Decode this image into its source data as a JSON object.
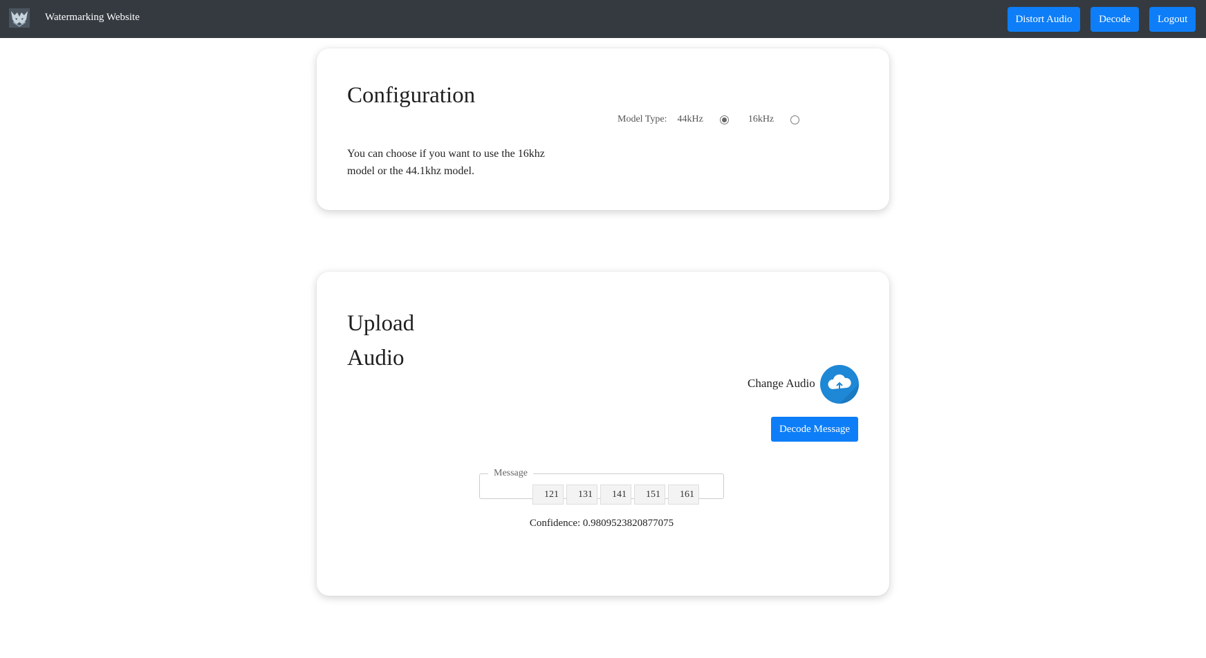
{
  "navbar": {
    "brand": "Watermarking Website",
    "buttons": {
      "distort": "Distort Audio",
      "decode": "Decode",
      "logout": "Logout"
    }
  },
  "config": {
    "title": "Configuration",
    "description": "You can choose if you want to use the 16khz model or the 44.1khz model.",
    "model_type_label": "Model Type:",
    "options": [
      {
        "label": "44kHz",
        "checked": true
      },
      {
        "label": "16kHz",
        "checked": false
      }
    ]
  },
  "upload": {
    "title": "Upload Audio",
    "change_audio_label": "Change Audio",
    "decode_button": "Decode Message",
    "message_legend": "Message",
    "message_values": [
      "121",
      "131",
      "141",
      "151",
      "161"
    ],
    "confidence": "Confidence: 0.9809523820877075"
  },
  "colors": {
    "navbar": "#343a40",
    "primary": "#0d7ef7",
    "upload_icon": "#1e87d6"
  },
  "icons": {
    "brand": "wolf-logo-icon",
    "upload": "cloud-upload-icon"
  }
}
